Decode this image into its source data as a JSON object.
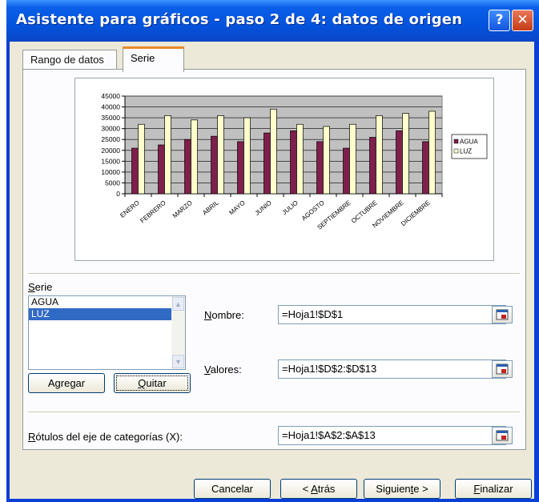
{
  "window": {
    "title": "Asistente para gráficos - paso 2 de 4: datos de origen",
    "help_label": "?",
    "close_label": "✕"
  },
  "tabs": [
    {
      "label": "Rango de datos"
    },
    {
      "label": "Serie"
    }
  ],
  "chart_data": {
    "type": "bar",
    "categories": [
      "ENERO",
      "FEBRERO",
      "MARZO",
      "ABRIL",
      "MAYO",
      "JUNIO",
      "JULIO",
      "AGOSTO",
      "SEPTIEMBRE",
      "OCTUBRE",
      "NOVIEMBRE",
      "DICIEMBRE"
    ],
    "series": [
      {
        "name": "AGUA",
        "values": [
          21000,
          22500,
          25000,
          26500,
          24000,
          28000,
          29000,
          24000,
          21000,
          26000,
          29000,
          24000
        ],
        "color": "#7f1f4c"
      },
      {
        "name": "LUZ",
        "values": [
          32000,
          36000,
          34000,
          36000,
          35000,
          39000,
          32000,
          31000,
          32000,
          36000,
          37000,
          38000
        ],
        "color": "#ffffcc"
      }
    ],
    "yticks": [
      "45000",
      "40000",
      "35000",
      "30000",
      "25000",
      "20000",
      "15000",
      "10000",
      "5000",
      "0"
    ],
    "ylim": [
      0,
      45000
    ],
    "grid": true,
    "plot_background": "#c0c0c0",
    "legend_position": "right"
  },
  "serie_section": {
    "label_prefix": "",
    "label_underlined": "S",
    "label_rest": "erie",
    "items": [
      "AGUA",
      "LUZ"
    ],
    "selected_index": 1
  },
  "nombre": {
    "label_underlined": "N",
    "label_rest": "ombre:",
    "value": "=Hoja1!$D$1"
  },
  "valores": {
    "label_underlined": "V",
    "label_rest": "alores:",
    "value": "=Hoja1!$D$2:$D$13"
  },
  "rotulos": {
    "label_underlined": "R",
    "label_rest": "ótulos del eje de categorías (X):",
    "value": "=Hoja1!$A$2:$A$13"
  },
  "buttons": {
    "agregar_pre": "A",
    "agregar_u": "g",
    "agregar_post": "regar",
    "quitar_u": "Q",
    "quitar_post": "uitar",
    "cancelar": "Cancelar",
    "atras_pre": "< ",
    "atras_u": "A",
    "atras_post": "trás",
    "siguiente_pre": "Siguien",
    "siguiente_u": "t",
    "siguiente_post": "e >",
    "finalizar_u": "F",
    "finalizar_post": "inalizar"
  }
}
